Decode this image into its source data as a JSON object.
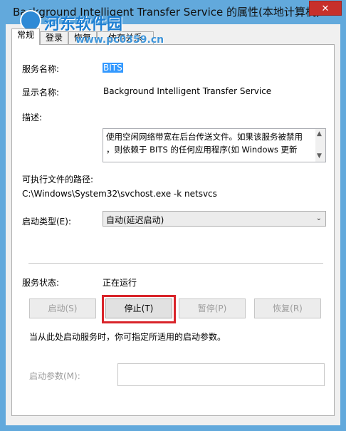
{
  "window": {
    "title": "Background Intelligent Transfer Service 的属性(本地计算机)",
    "close_glyph": "✕"
  },
  "watermark": {
    "name": "河东软件园",
    "url": "www.pc0359.cn"
  },
  "tabs": [
    {
      "label": "常规",
      "active": true
    },
    {
      "label": "登录",
      "active": false
    },
    {
      "label": "恢复",
      "active": false
    },
    {
      "label": "依存关系",
      "active": false
    }
  ],
  "general": {
    "service_name_label": "服务名称:",
    "service_name_value": "BITS",
    "display_name_label": "显示名称:",
    "display_name_value": "Background Intelligent Transfer Service",
    "description_label": "描述:",
    "description_value": "使用空闲网络带宽在后台传送文件。如果该服务被禁用\n，则依赖于 BITS 的任何应用程序(如 Windows 更新",
    "exe_path_label": "可执行文件的路径:",
    "exe_path_value": "C:\\Windows\\System32\\svchost.exe -k netsvcs",
    "startup_type_label": "启动类型(E):",
    "startup_type_value": "自动(延迟启动)",
    "status_label": "服务状态:",
    "status_value": "正在运行",
    "buttons": {
      "start": "启动(S)",
      "stop": "停止(T)",
      "pause": "暂停(P)",
      "resume": "恢复(R)"
    },
    "hint": "当从此处启动服务时，你可指定所适用的启动参数。",
    "start_params_label": "启动参数(M):",
    "start_params_value": ""
  },
  "icons": {
    "scroll_up": "▲",
    "scroll_down": "▼",
    "dropdown": "⌄"
  },
  "colors": {
    "title_bar": "#62a9dc",
    "close_button": "#c7302b",
    "highlight_box": "#d9242a",
    "selection": "#3399ff"
  }
}
